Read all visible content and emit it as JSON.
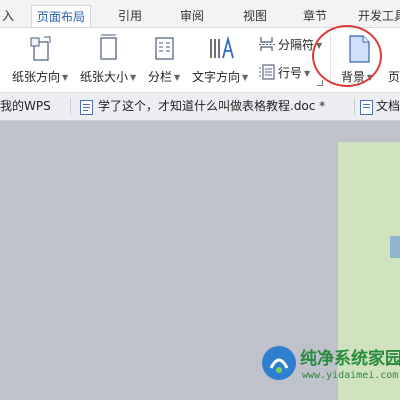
{
  "ribbon_tabs": [
    "入",
    "页面布局",
    "引用",
    "审阅",
    "视图",
    "章节",
    "开发工具"
  ],
  "ribbon_buttons": {
    "orientation": "纸张方向",
    "paper_size": "纸张大小",
    "columns": "分栏",
    "text_direction": "文字方向",
    "breaks": "分隔符",
    "line_numbers": "行号",
    "background": "背景",
    "page_border_partial": "页"
  },
  "document_tabs": [
    "我的WPS",
    "学了这个，才知道什么叫做表格教程.doc *",
    "文档"
  ],
  "watermark": {
    "title": "纯净系统家园",
    "url": "www.yidaimei.com"
  },
  "colors": {
    "active_tab_text": "#2a5db0",
    "annotation_circle": "#e03a3a",
    "workspace_bg": "#bfc1cb",
    "page_fill": "#cfe4be"
  }
}
